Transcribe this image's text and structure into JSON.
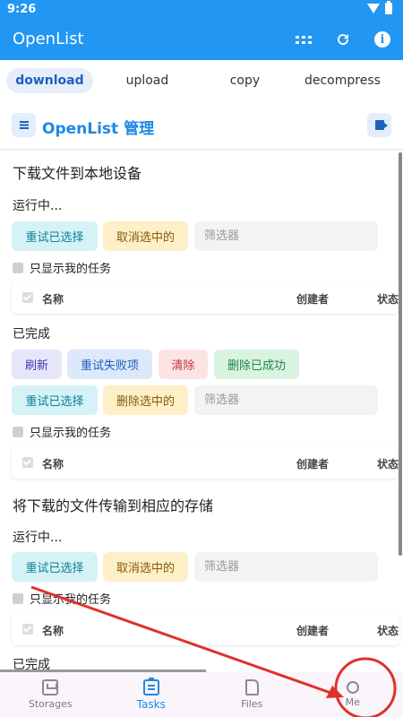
{
  "status": {
    "time": "9:26"
  },
  "app": {
    "title": "OpenList"
  },
  "tabs": [
    {
      "label": "download"
    },
    {
      "label": "upload"
    },
    {
      "label": "copy"
    },
    {
      "label": "decompress"
    }
  ],
  "header": {
    "title": "OpenList 管理"
  },
  "section1": {
    "title": "下载文件到本地设备",
    "running": {
      "title": "运行中...",
      "retry_selected": "重试已选择",
      "cancel_selected": "取消选中的",
      "filter_placeholder": "筛选器",
      "only_mine": "只显示我的任务",
      "columns": {
        "name": "名称",
        "creator": "创建者",
        "status": "状态"
      }
    },
    "done": {
      "title": "已完成",
      "refresh": "刷新",
      "retry_failed": "重试失败项",
      "clear": "清除",
      "delete_success": "删除已成功",
      "retry_selected": "重试已选择",
      "delete_selected": "删除选中的",
      "filter_placeholder": "筛选器",
      "only_mine": "只显示我的任务",
      "columns": {
        "name": "名称",
        "creator": "创建者",
        "status": "状态"
      }
    }
  },
  "section2": {
    "title": "将下载的文件传输到相应的存储",
    "running": {
      "title": "运行中...",
      "retry_selected": "重试已选择",
      "cancel_selected": "取消选中的",
      "filter_placeholder": "筛选器",
      "only_mine": "只显示我的任务",
      "columns": {
        "name": "名称",
        "creator": "创建者",
        "status": "状态"
      }
    },
    "done": {
      "title": "已完成"
    }
  },
  "bottom_nav": [
    {
      "label": "Storages",
      "icon": "storage-icon"
    },
    {
      "label": "Tasks",
      "icon": "tasks-icon"
    },
    {
      "label": "Files",
      "icon": "file-icon"
    },
    {
      "label": "Me",
      "icon": "person-icon"
    }
  ],
  "colors": {
    "primary": "#2196f3",
    "active_tab_bg": "#e8eef9",
    "annotation_red": "#e0312b"
  }
}
